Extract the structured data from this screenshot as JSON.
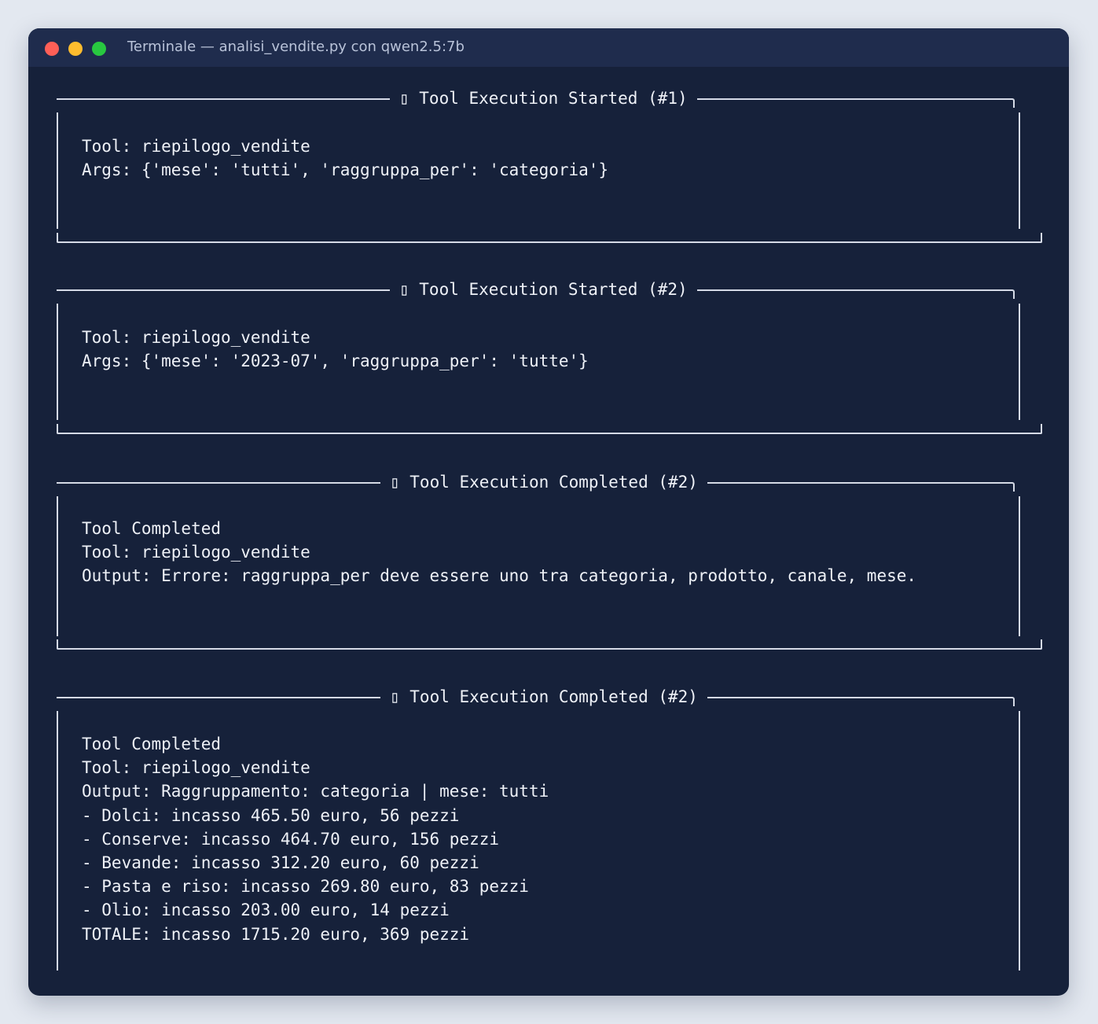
{
  "window": {
    "title": "Terminale — analisi_vendite.py con qwen2.5:7b"
  },
  "panels": [
    {
      "title": "▯ Tool Execution Started (#1)",
      "lines": [
        "Tool: riepilogo_vendite",
        "Args: {'mese': 'tutti', 'raggruppa_per': 'categoria'}"
      ]
    },
    {
      "title": "▯ Tool Execution Started (#2)",
      "lines": [
        "Tool: riepilogo_vendite",
        "Args: {'mese': '2023-07', 'raggruppa_per': 'tutte'}"
      ]
    },
    {
      "title": "▯ Tool Execution Completed (#2)",
      "lines": [
        "Tool Completed",
        "Tool: riepilogo_vendite",
        "Output: Errore: raggruppa_per deve essere uno tra categoria, prodotto, canale, mese."
      ]
    },
    {
      "title": "▯ Tool Execution Completed (#2)",
      "lines": [
        "Tool Completed",
        "Tool: riepilogo_vendite",
        "Output: Raggruppamento: categoria | mese: tutti",
        "- Dolci: incasso 465.50 euro, 56 pezzi",
        "- Conserve: incasso 464.70 euro, 156 pezzi",
        "- Bevande: incasso 312.20 euro, 60 pezzi",
        "- Pasta e riso: incasso 269.80 euro, 83 pezzi",
        "- Olio: incasso 203.00 euro, 14 pezzi",
        "TOTALE: incasso 1715.20 euro, 369 pezzi"
      ]
    }
  ]
}
